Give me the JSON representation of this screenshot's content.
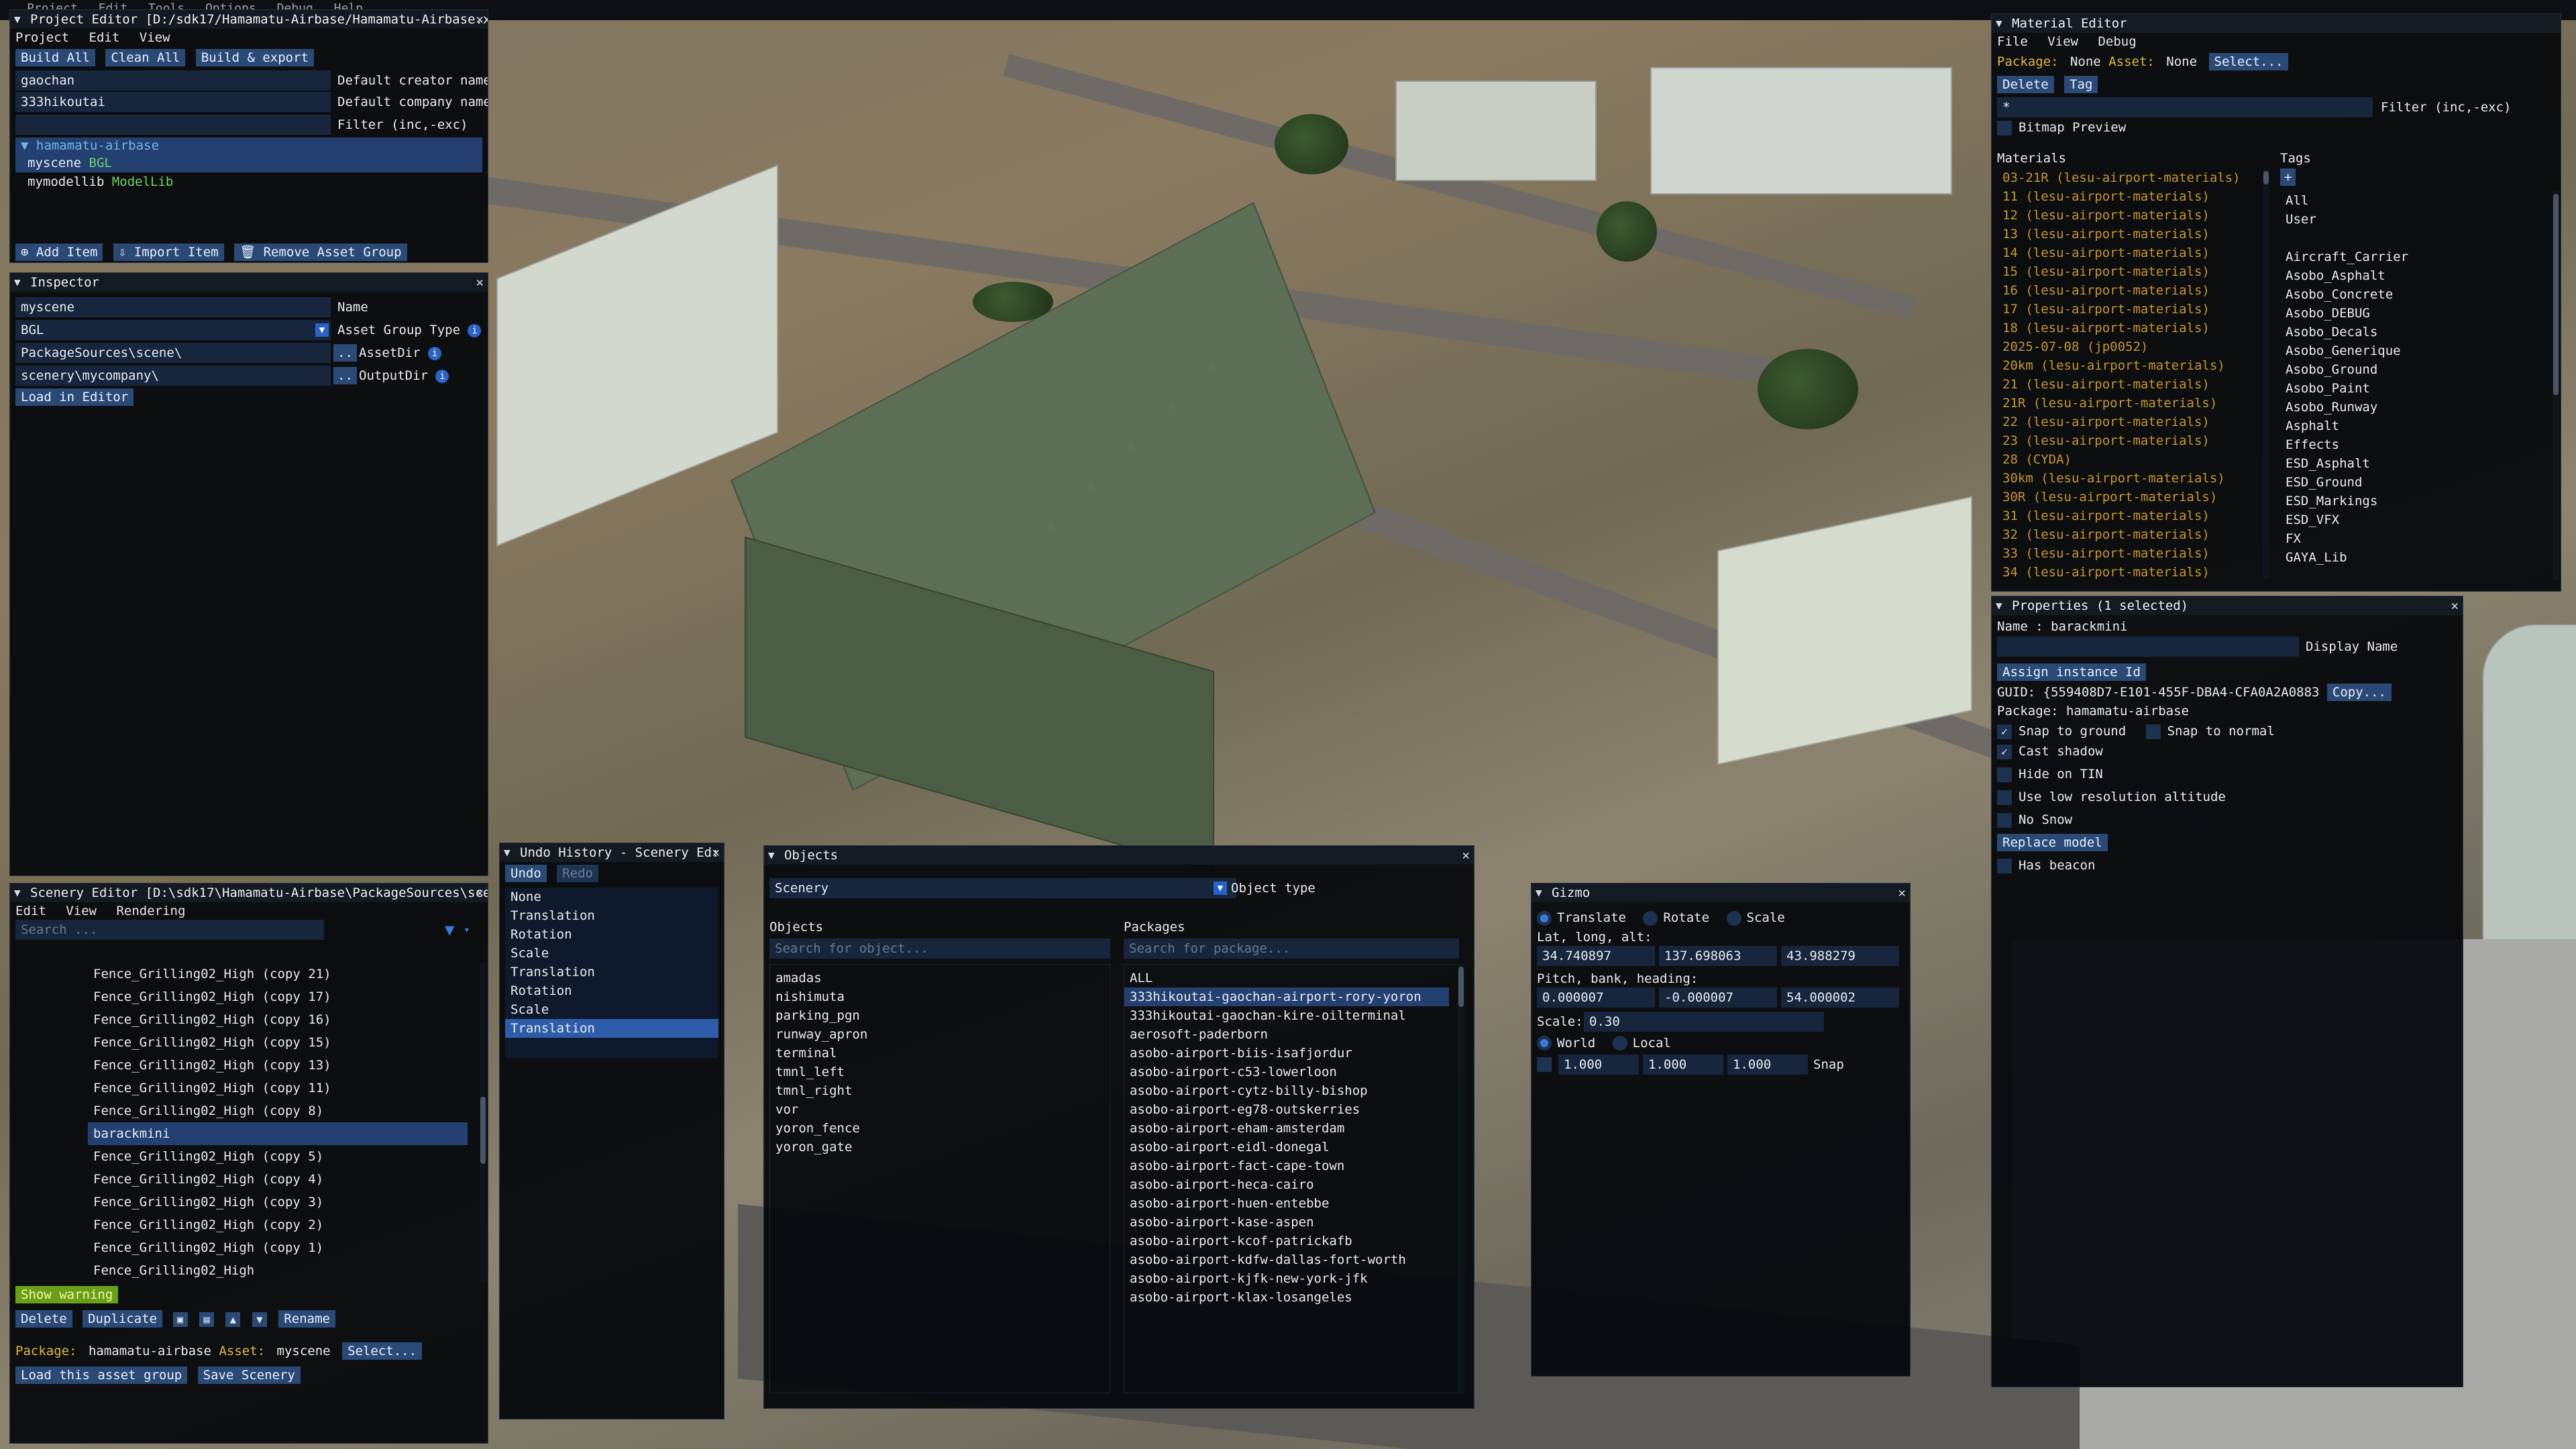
{
  "topbar": {
    "items": [
      "Project",
      "Edit",
      "Tools",
      "Options",
      "Debug",
      "Help"
    ]
  },
  "project_editor": {
    "title": "Project Editor [D:/sdk17/Hamamatu-Airbase/Hamamatu-Airbase.x",
    "menu": [
      "Project",
      "Edit",
      "View"
    ],
    "buttons": [
      "Build All",
      "Clean All",
      "Build & export"
    ],
    "creator_value": "gaochan",
    "creator_label": "Default creator name",
    "company_value": "333hikoutai",
    "company_label": "Default company name",
    "filter_label": "Filter (inc,-exc)",
    "tree_root": "hamamatu-airbase",
    "tree_items": [
      {
        "name": "myscene",
        "tag": "BGL"
      },
      {
        "name": "mymodellib",
        "tag": "ModelLib"
      }
    ],
    "bottom_buttons": [
      "Add Item",
      "Import Item",
      "Remove Asset Group"
    ]
  },
  "inspector": {
    "title": "Inspector",
    "rows": [
      {
        "value": "myscene",
        "label": "Name"
      },
      {
        "value": "BGL",
        "label": "Asset Group Type"
      },
      {
        "value": "PackageSources\\scene\\",
        "label": "AssetDir"
      },
      {
        "value": "scenery\\mycompany\\",
        "label": "OutputDir"
      }
    ],
    "dots": "..",
    "load_button": "Load in Editor"
  },
  "scenery_editor": {
    "title": "Scenery Editor [D:\\sdk17\\Hamamatu-Airbase\\PackageSources\\sce",
    "menu": [
      "Edit",
      "View",
      "Rendering"
    ],
    "search_placeholder": "Search ...",
    "items": [
      "Fence_Grilling02_High (copy 21)",
      "Fence_Grilling02_High (copy 17)",
      "Fence_Grilling02_High (copy 16)",
      "Fence_Grilling02_High (copy 15)",
      "Fence_Grilling02_High (copy 13)",
      "Fence_Grilling02_High (copy 11)",
      "Fence_Grilling02_High (copy 8)",
      "barackmini",
      "Fence_Grilling02_High (copy 5)",
      "Fence_Grilling02_High (copy 4)",
      "Fence_Grilling02_High (copy 3)",
      "Fence_Grilling02_High (copy 2)",
      "Fence_Grilling02_High (copy 1)",
      "Fence_Grilling02_High"
    ],
    "selected_index": 7,
    "show_warning": "Show warning",
    "delete": "Delete",
    "duplicate": "Duplicate",
    "rename": "Rename",
    "package_label": "Package:",
    "package_value": "hamamatu-airbase",
    "asset_label": "Asset:",
    "asset_value": "myscene",
    "select_button": "Select...",
    "load_button": "Load this asset group",
    "save_button": "Save Scenery"
  },
  "undo_history": {
    "title": "Undo History - Scenery Ed:",
    "undo": "Undo",
    "redo": "Redo",
    "items": [
      "None",
      "Translation",
      "Rotation",
      "Scale",
      "Translation",
      "Rotation",
      "Scale",
      "Translation"
    ],
    "selected_index": 7
  },
  "objects": {
    "title": "Objects",
    "type_value": "Scenery",
    "type_label": "Object type",
    "objects_header": "Objects",
    "packages_header": "Packages",
    "object_search": "Search for object...",
    "package_search": "Search for package...",
    "object_list": [
      "amadas",
      "nishimuta",
      "parking_pgn",
      "runway_apron",
      "terminal",
      "tmnl_left",
      "tmnl_right",
      "vor",
      "yoron_fence",
      "yoron_gate"
    ],
    "package_list": [
      "ALL",
      "333hikoutai-gaochan-airport-rory-yoron",
      "333hikoutai-gaochan-kire-oilterminal",
      "aerosoft-paderborn",
      "asobo-airport-biis-isafjordur",
      "asobo-airport-c53-lowerloon",
      "asobo-airport-cytz-billy-bishop",
      "asobo-airport-eg78-outskerries",
      "asobo-airport-eham-amsterdam",
      "asobo-airport-eidl-donegal",
      "asobo-airport-fact-cape-town",
      "asobo-airport-heca-cairo",
      "asobo-airport-huen-entebbe",
      "asobo-airport-kase-aspen",
      "asobo-airport-kcof-patrickafb",
      "asobo-airport-kdfw-dallas-fort-worth",
      "asobo-airport-kjfk-new-york-jfk",
      "asobo-airport-klax-losangeles"
    ],
    "package_selected_index": 1
  },
  "gizmo": {
    "title": "Gizmo",
    "modes": [
      "Translate",
      "Rotate",
      "Scale"
    ],
    "mode_selected": 0,
    "lla_label": "Lat, long, alt:",
    "lla": [
      "34.740897",
      "137.698063",
      "43.988279"
    ],
    "pbh_label": "Pitch, bank, heading:",
    "pbh": [
      "0.000007",
      "-0.000007",
      "54.000002"
    ],
    "scale_label": "Scale:",
    "scale_value": "0.30",
    "space": [
      "World",
      "Local"
    ],
    "space_selected": 0,
    "snap_values": [
      "1.000",
      "1.000",
      "1.000"
    ],
    "snap_label": "Snap"
  },
  "material_editor": {
    "title": "Material Editor",
    "menu": [
      "File",
      "View",
      "Debug"
    ],
    "package_label": "Package:",
    "package_value": "None",
    "asset_label": "Asset:",
    "asset_value": "None",
    "select_button": "Select...",
    "delete": "Delete",
    "tag": "Tag",
    "filter_prefix": "*",
    "filter_label": "Filter (inc,-exc)",
    "bitmap_preview": "Bitmap Preview",
    "materials_header": "Materials",
    "tags_header": "Tags",
    "materials": [
      "03-21R (lesu-airport-materials)",
      "11 (lesu-airport-materials)",
      "12 (lesu-airport-materials)",
      "13 (lesu-airport-materials)",
      "14 (lesu-airport-materials)",
      "15 (lesu-airport-materials)",
      "16 (lesu-airport-materials)",
      "17 (lesu-airport-materials)",
      "18 (lesu-airport-materials)",
      "2025-07-08 (jp0052)",
      "20km (lesu-airport-materials)",
      "21 (lesu-airport-materials)",
      "21R (lesu-airport-materials)",
      "22 (lesu-airport-materials)",
      "23 (lesu-airport-materials)",
      "28 (CYDA)",
      "30km (lesu-airport-materials)",
      "30R (lesu-airport-materials)",
      "31 (lesu-airport-materials)",
      "32 (lesu-airport-materials)",
      "33 (lesu-airport-materials)",
      "34 (lesu-airport-materials)"
    ],
    "tags_plus": "+",
    "tags_top": [
      "All",
      "User"
    ],
    "tags": [
      "Aircraft_Carrier",
      "Asobo_Asphalt",
      "Asobo_Concrete",
      "Asobo_DEBUG",
      "Asobo_Decals",
      "Asobo_Generique",
      "Asobo_Ground",
      "Asobo_Paint",
      "Asobo_Runway",
      "Asphalt",
      "Effects",
      "ESD_Asphalt",
      "ESD_Ground",
      "ESD_Markings",
      "ESD_VFX",
      "FX",
      "GAYA_Lib"
    ]
  },
  "properties": {
    "title": "Properties (1 selected)",
    "name_label": "Name :",
    "name_value": "barackmini",
    "display_name": "Display Name",
    "assign_button": "Assign instance Id",
    "guid_label": "GUID:",
    "guid_value": "{559408D7-E101-455F-DBA4-CFA0A2A0883",
    "copy_button": "Copy...",
    "package_label": "Package:",
    "package_value": "hamamatu-airbase",
    "checks": [
      {
        "label": "Snap to ground",
        "checked": true
      },
      {
        "label": "Cast shadow",
        "checked": true
      },
      {
        "label": "Hide on TIN",
        "checked": false
      },
      {
        "label": "Use low resolution altitude",
        "checked": false
      },
      {
        "label": "No Snow",
        "checked": false
      }
    ],
    "snap_normal": "Snap to normal",
    "replace_button": "Replace model",
    "has_beacon": "Has beacon"
  }
}
